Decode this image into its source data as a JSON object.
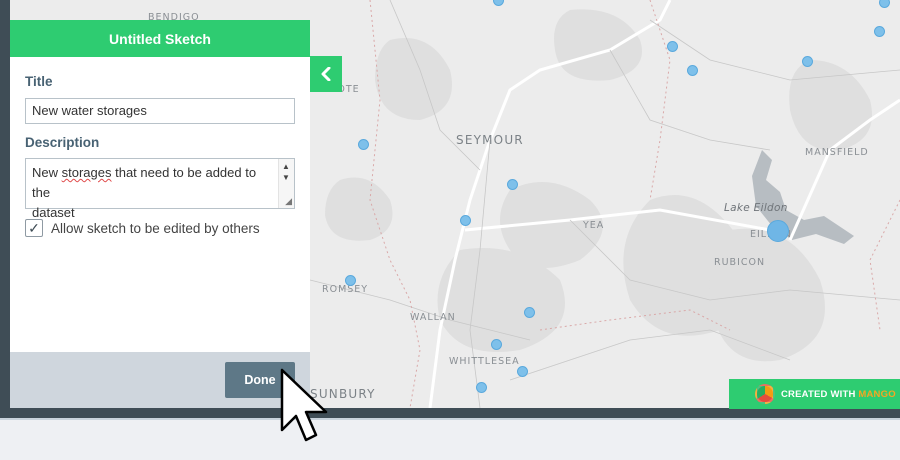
{
  "panel": {
    "header_title": "Untitled Sketch",
    "title_label": "Title",
    "title_value": "New water storages",
    "description_label": "Description",
    "description_value_line1_pre": "New ",
    "description_value_line1_misspelled": "storages",
    "description_value_line1_post": " that need to be added to the",
    "description_value_line2": "dataset",
    "allow_edit_label": "Allow sketch to be edited by others",
    "allow_edit_checked": true,
    "done_label": "Done"
  },
  "map": {
    "labels": [
      "BENDIGO",
      "ATHCOTE",
      "SEYMOUR",
      "MANSFIELD",
      "Lake Eildon",
      "EILDON",
      "YEA",
      "RUBICON",
      "ROMSEY",
      "WALLAN",
      "WHITTLESEA",
      "SUNBURY"
    ],
    "marker_color": "#7ec0ea"
  },
  "badge": {
    "prefix": "CREATED WITH",
    "brand": "MANGO"
  },
  "colors": {
    "accent": "#2ecc71",
    "done_button": "#5e7887",
    "frame": "#3f4d56"
  },
  "icons": {
    "collapse": "chevron-left-icon",
    "checkbox": "checkmark-icon",
    "cursor": "mouse-pointer-icon",
    "logo": "mango-logo-icon"
  }
}
